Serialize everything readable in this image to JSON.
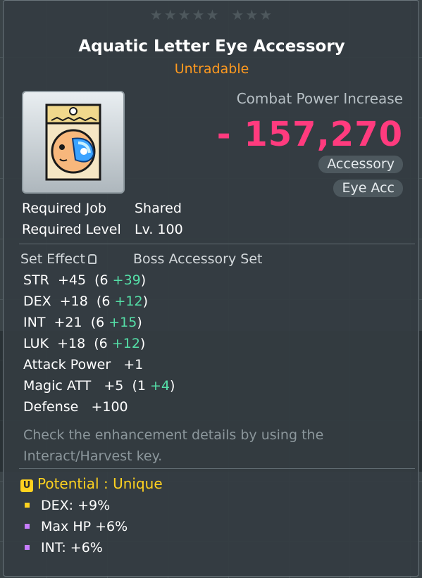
{
  "item": {
    "name": "Aquatic Letter Eye Accessory",
    "tradability": "Untradable",
    "stars_left": "★★★★★",
    "stars_right": "★★★"
  },
  "combat_power": {
    "label": "Combat Power Increase",
    "value": "- 157,270"
  },
  "tags": {
    "category": "Accessory",
    "subcategory": "Eye Acc"
  },
  "requirements": {
    "job_label": "Required Job",
    "job_value": "Shared",
    "level_label": "Required Level",
    "level_value": "Lv. 100"
  },
  "set_effect": {
    "label": "Set Effect",
    "value": "Boss Accessory Set"
  },
  "stats": [
    {
      "name": "STR",
      "main": "  +45  (6 ",
      "bonus": "+39",
      "close": ")"
    },
    {
      "name": "DEX",
      "main": "  +18  (6 ",
      "bonus": "+12",
      "close": ")"
    },
    {
      "name": "INT",
      "main": "  +21  (6 ",
      "bonus": "+15",
      "close": ")"
    },
    {
      "name": "LUK",
      "main": "  +18  (6 ",
      "bonus": "+12",
      "close": ")"
    },
    {
      "name": "Attack Power",
      "main": "   +1",
      "bonus": "",
      "close": ""
    },
    {
      "name": "Magic ATT",
      "main": "   +5  (1 ",
      "bonus": "+4",
      "close": ")"
    },
    {
      "name": "Defense",
      "main": "   +100",
      "bonus": "",
      "close": ""
    }
  ],
  "note": "Check the enhancement details by using the Interact/Harvest key.",
  "potential": {
    "badge": "U",
    "label": "Potential : Unique",
    "lines": [
      {
        "text": "DEX: +9%",
        "bullet_color": "#ffd21f"
      },
      {
        "text": "Max HP +6%",
        "bullet_color": "#c77dff"
      },
      {
        "text": "INT: +6%",
        "bullet_color": "#c77dff"
      }
    ]
  },
  "colors": {
    "item_name": "#ffffff",
    "untradable": "#ff9a1f",
    "combat_power": "#ff3b7e",
    "stat_bonus": "#55e0a8",
    "potential_unique": "#ffd21f"
  },
  "icon": "aquatic-letter-eye-accessory-icon"
}
